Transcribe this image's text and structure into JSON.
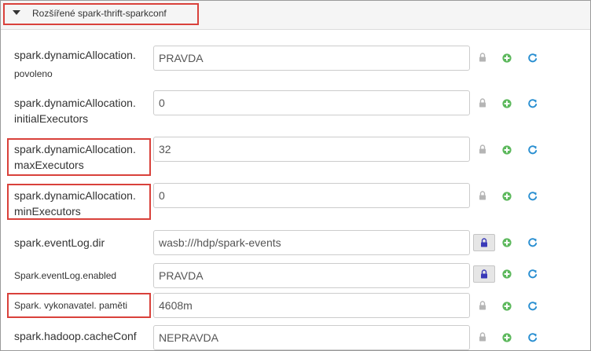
{
  "section": {
    "title": "Rozšířené spark-thrift-sparkconf"
  },
  "properties": [
    {
      "label_line1": "spark.dynamicAllocation.",
      "label_line2": "povoleno",
      "value": "PRAVDA",
      "lock_state": "unlocked"
    },
    {
      "label_line1": "spark.dynamicAllocation.",
      "label_line2": "initialExecutors",
      "value": "0",
      "lock_state": "unlocked"
    },
    {
      "label_line1": "spark.dynamicAllocation.",
      "label_line2": "maxExecutors",
      "value": "32",
      "lock_state": "unlocked",
      "highlighted": true
    },
    {
      "label_line1": "spark.dynamicAllocation.",
      "label_line2": "minExecutors",
      "value": "0",
      "lock_state": "unlocked",
      "highlighted": true
    },
    {
      "label_line1": "spark.eventLog.dir",
      "value": "wasb:///hdp/spark-events",
      "lock_state": "locked"
    },
    {
      "label_line1": "Spark.eventLog.enabled",
      "value": "PRAVDA",
      "lock_state": "locked"
    },
    {
      "label_line1": "Spark. vykonavatel. paměti",
      "value": "4608m",
      "lock_state": "unlocked",
      "highlighted": true
    },
    {
      "label_line1": "spark.hadoop.cacheConf",
      "value": "NEPRAVDA",
      "lock_state": "unlocked"
    }
  ],
  "icons": {
    "lock": "lock-icon",
    "add": "plus-circle-icon",
    "reset": "refresh-icon"
  },
  "colors": {
    "add_green": "#5cb85c",
    "refresh_blue": "#2a8fd1",
    "lock_grey": "#b5b5b5",
    "lock_active": "#3a3ab8",
    "highlight_red": "#d9413b"
  }
}
